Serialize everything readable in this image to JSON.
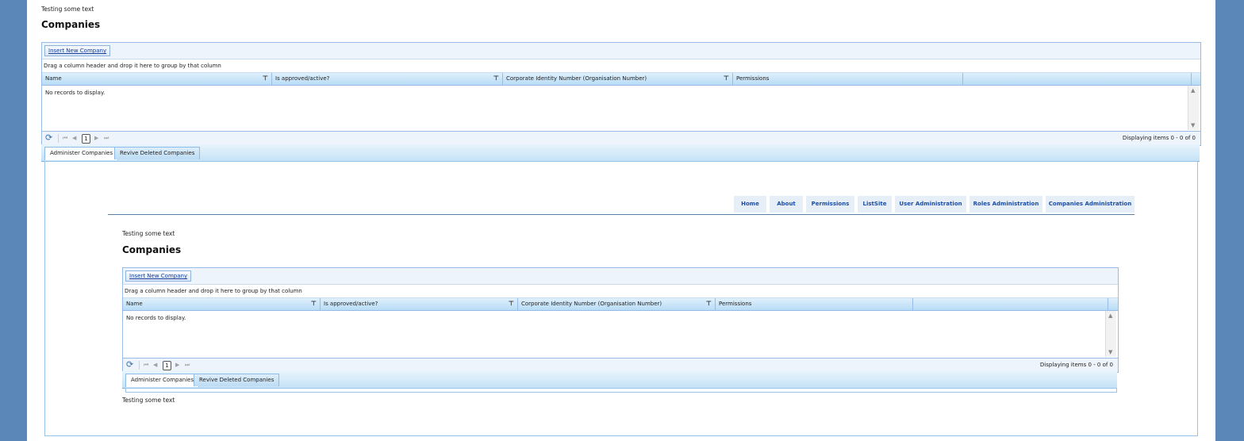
{
  "top": {
    "caption": "Testing some text",
    "title": "Companies"
  },
  "grid": {
    "insert_label": "Insert New Company",
    "group_hint": "Drag a column header and drop it here to group by that column",
    "columns": [
      "Name",
      "Is approved/active?",
      "Corporate Identity Number (Organisation Number)",
      "Permissions"
    ],
    "no_records": "No records to display.",
    "pager": {
      "first": "⏮",
      "prev": "◀",
      "page": "1",
      "next": "▶",
      "last": "⏭",
      "info": "Displaying items 0 - 0 of 0"
    }
  },
  "tabs": [
    "Administer Companies",
    "Revive Deleted Companies"
  ],
  "nav": [
    "Home",
    "About",
    "Permissions",
    "ListSite",
    "User Administration",
    "Roles Administration",
    "Companies Administration"
  ],
  "inner": {
    "caption": "Testing some text",
    "title": "Companies",
    "footer_caption": "Testing some text"
  },
  "colors": {
    "background": "#5a86b8",
    "grid_border": "#99bbe8",
    "link": "#1d4ea6"
  },
  "icons": {
    "refresh": "refresh-icon",
    "filter": "filter-icon",
    "scroll_up": "scroll-up-icon",
    "scroll_down": "scroll-down-icon"
  }
}
